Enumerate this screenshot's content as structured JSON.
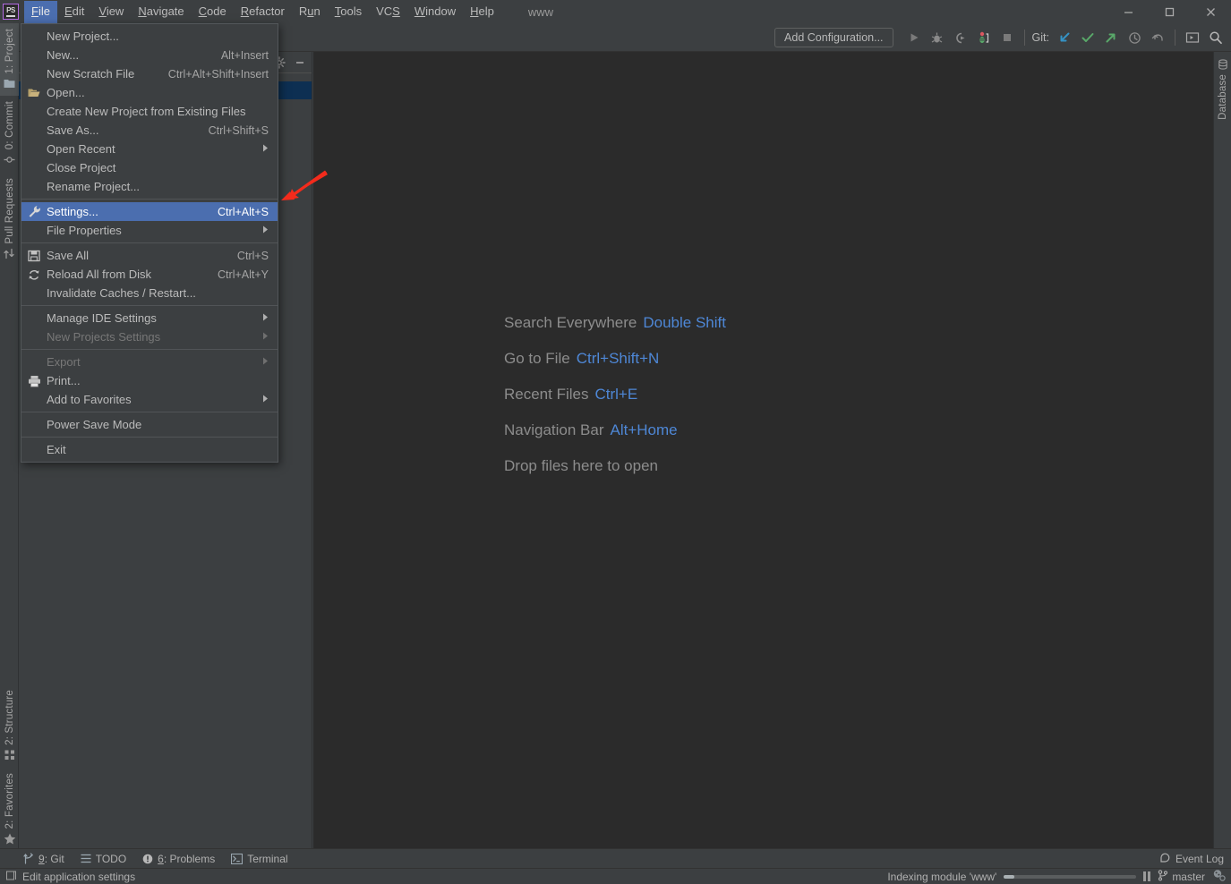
{
  "window": {
    "title_project": "www",
    "controls": [
      {
        "name": "minimize-button",
        "label": "—"
      },
      {
        "name": "maximize-button",
        "label": "□"
      },
      {
        "name": "close-button",
        "label": "✕"
      }
    ]
  },
  "logo": {
    "text": "PS"
  },
  "menubar": {
    "items": [
      {
        "label": "File",
        "accel": "F",
        "active": true
      },
      {
        "label": "Edit",
        "accel": "E",
        "active": false
      },
      {
        "label": "View",
        "accel": "V",
        "active": false
      },
      {
        "label": "Navigate",
        "accel": "N",
        "active": false
      },
      {
        "label": "Code",
        "accel": "C",
        "active": false
      },
      {
        "label": "Refactor",
        "accel": "R",
        "active": false
      },
      {
        "label": "Run",
        "accel": "u",
        "active": false
      },
      {
        "label": "Tools",
        "accel": "T",
        "active": false
      },
      {
        "label": "VCS",
        "accel": "S",
        "active": false
      },
      {
        "label": "Window",
        "accel": "W",
        "active": false
      },
      {
        "label": "Help",
        "accel": "H",
        "active": false
      }
    ]
  },
  "file_menu": {
    "groups": [
      [
        {
          "label": "New Project...",
          "shortcut": "",
          "icon": "",
          "submenu": false,
          "disabled": false,
          "highlight": false
        },
        {
          "label": "New...",
          "shortcut": "Alt+Insert",
          "icon": "",
          "submenu": false,
          "disabled": false,
          "highlight": false
        },
        {
          "label": "New Scratch File",
          "shortcut": "Ctrl+Alt+Shift+Insert",
          "icon": "",
          "submenu": false,
          "disabled": false,
          "highlight": false
        },
        {
          "label": "Open...",
          "shortcut": "",
          "icon": "folder-open-icon",
          "submenu": false,
          "disabled": false,
          "highlight": false
        },
        {
          "label": "Create New Project from Existing Files",
          "shortcut": "",
          "icon": "",
          "submenu": false,
          "disabled": false,
          "highlight": false
        },
        {
          "label": "Save As...",
          "shortcut": "Ctrl+Shift+S",
          "icon": "",
          "submenu": false,
          "disabled": false,
          "highlight": false
        },
        {
          "label": "Open Recent",
          "shortcut": "",
          "icon": "",
          "submenu": true,
          "disabled": false,
          "highlight": false
        },
        {
          "label": "Close Project",
          "shortcut": "",
          "icon": "",
          "submenu": false,
          "disabled": false,
          "highlight": false
        },
        {
          "label": "Rename Project...",
          "shortcut": "",
          "icon": "",
          "submenu": false,
          "disabled": false,
          "highlight": false
        }
      ],
      [
        {
          "label": "Settings...",
          "shortcut": "Ctrl+Alt+S",
          "icon": "wrench-icon",
          "submenu": false,
          "disabled": false,
          "highlight": true
        },
        {
          "label": "File Properties",
          "shortcut": "",
          "icon": "",
          "submenu": true,
          "disabled": false,
          "highlight": false
        }
      ],
      [
        {
          "label": "Save All",
          "shortcut": "Ctrl+S",
          "icon": "save-icon",
          "submenu": false,
          "disabled": false,
          "highlight": false
        },
        {
          "label": "Reload All from Disk",
          "shortcut": "Ctrl+Alt+Y",
          "icon": "refresh-icon",
          "submenu": false,
          "disabled": false,
          "highlight": false
        },
        {
          "label": "Invalidate Caches / Restart...",
          "shortcut": "",
          "icon": "",
          "submenu": false,
          "disabled": false,
          "highlight": false
        }
      ],
      [
        {
          "label": "Manage IDE Settings",
          "shortcut": "",
          "icon": "",
          "submenu": true,
          "disabled": false,
          "highlight": false
        },
        {
          "label": "New Projects Settings",
          "shortcut": "",
          "icon": "",
          "submenu": true,
          "disabled": true,
          "highlight": false
        }
      ],
      [
        {
          "label": "Export",
          "shortcut": "",
          "icon": "",
          "submenu": true,
          "disabled": true,
          "highlight": false
        },
        {
          "label": "Print...",
          "shortcut": "",
          "icon": "printer-icon",
          "submenu": false,
          "disabled": false,
          "highlight": false
        },
        {
          "label": "Add to Favorites",
          "shortcut": "",
          "icon": "",
          "submenu": true,
          "disabled": false,
          "highlight": false
        }
      ],
      [
        {
          "label": "Power Save Mode",
          "shortcut": "",
          "icon": "",
          "submenu": false,
          "disabled": false,
          "highlight": false
        }
      ],
      [
        {
          "label": "Exit",
          "shortcut": "",
          "icon": "",
          "submenu": false,
          "disabled": false,
          "highlight": false
        }
      ]
    ]
  },
  "toolbar": {
    "add_configuration_label": "Add Configuration...",
    "git_label": "Git:",
    "buttons": [
      {
        "name": "run-button",
        "icon": "play-icon"
      },
      {
        "name": "debug-button",
        "icon": "bug-icon"
      },
      {
        "name": "run-with-coverage-button",
        "icon": "coverage-icon"
      },
      {
        "name": "profile-button",
        "icon": "profiler-icon"
      },
      {
        "name": "stop-button",
        "icon": "stop-icon"
      }
    ],
    "git_buttons": [
      {
        "name": "update-project-button",
        "icon": "arrow-down-left-icon",
        "color": "#3592c4"
      },
      {
        "name": "commit-button",
        "icon": "checkmark-icon",
        "color": "#59a869"
      },
      {
        "name": "push-button",
        "icon": "arrow-up-right-icon",
        "color": "#59a869"
      },
      {
        "name": "history-button",
        "icon": "clock-icon",
        "color": "#8a8a8a"
      },
      {
        "name": "rollback-button",
        "icon": "undo-icon",
        "color": "#8a8a8a"
      }
    ],
    "right_buttons": [
      {
        "name": "hide-window-button",
        "icon": "screen-icon"
      },
      {
        "name": "search-everywhere-button",
        "icon": "search-icon"
      }
    ]
  },
  "left_tool_strip": {
    "top": [
      {
        "label": "1: Project",
        "icon": "project-icon",
        "selected": true
      },
      {
        "label": "0: Commit",
        "icon": "commit-icon",
        "selected": false
      },
      {
        "label": "Pull Requests",
        "icon": "pull-request-icon",
        "selected": false
      }
    ],
    "bottom": [
      {
        "label": "2: Structure",
        "icon": "structure-icon",
        "selected": false
      },
      {
        "label": "2: Favorites",
        "icon": "star-icon",
        "selected": false
      }
    ]
  },
  "right_tool_strip": {
    "items": [
      {
        "label": "Database",
        "icon": "database-icon"
      }
    ]
  },
  "project_panel": {
    "header_buttons": [
      {
        "name": "project-settings-button",
        "icon": "gear-icon"
      },
      {
        "name": "hide-panel-button",
        "icon": "minimize-icon"
      }
    ]
  },
  "welcome": {
    "rows": [
      {
        "label": "Search Everywhere",
        "key": "Double Shift"
      },
      {
        "label": "Go to File",
        "key": "Ctrl+Shift+N"
      },
      {
        "label": "Recent Files",
        "key": "Ctrl+E"
      },
      {
        "label": "Navigation Bar",
        "key": "Alt+Home"
      },
      {
        "label": "Drop files here to open",
        "key": ""
      }
    ]
  },
  "bottom_tabs": {
    "items": [
      {
        "label": "9: Git",
        "accel": "9",
        "icon": "git-icon"
      },
      {
        "label": "TODO",
        "accel": "",
        "icon": "todo-icon"
      },
      {
        "label": "6: Problems",
        "accel": "6",
        "icon": "problems-icon"
      },
      {
        "label": "Terminal",
        "accel": "",
        "icon": "terminal-icon"
      }
    ],
    "event_log_label": "Event Log"
  },
  "status_bar": {
    "message": "Edit application settings",
    "indexing_text": "Indexing module 'www'",
    "progress_percent": 8,
    "branch": "master"
  },
  "colors": {
    "background": "#3c3f41",
    "editor_background": "#2b2b2b",
    "menu_highlight": "#4b6eaf",
    "accent_blue": "#4e87d6",
    "annotation_red": "#f32b1c",
    "git_green": "#59a869",
    "git_blue": "#3592c4"
  }
}
